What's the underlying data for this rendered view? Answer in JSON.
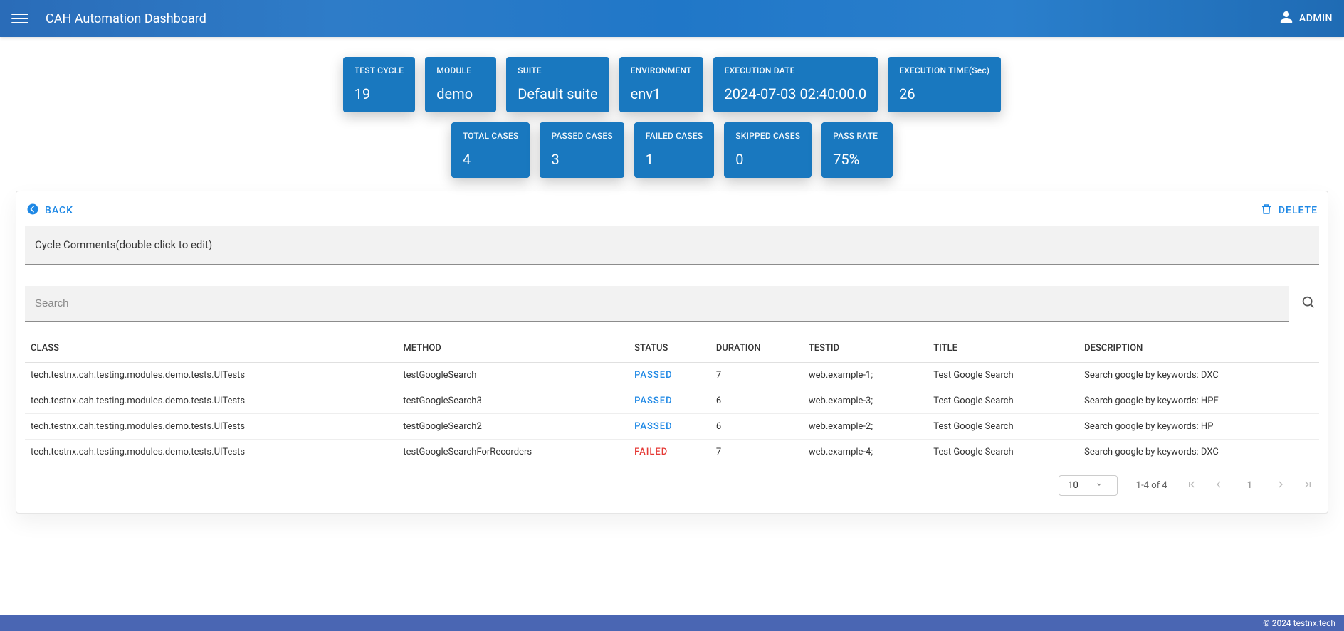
{
  "header": {
    "title": "CAH Automation Dashboard",
    "user": "ADMIN"
  },
  "summary": {
    "row1": [
      {
        "label": "TEST CYCLE",
        "value": "19"
      },
      {
        "label": "MODULE",
        "value": "demo"
      },
      {
        "label": "SUITE",
        "value": "Default suite"
      },
      {
        "label": "ENVIRONMENT",
        "value": "env1"
      },
      {
        "label": "EXECUTION DATE",
        "value": "2024-07-03 02:40:00.0"
      },
      {
        "label": "EXECUTION TIME(Sec)",
        "value": "26"
      }
    ],
    "row2": [
      {
        "label": "TOTAL CASES",
        "value": "4"
      },
      {
        "label": "PASSED CASES",
        "value": "3"
      },
      {
        "label": "FAILED CASES",
        "value": "1"
      },
      {
        "label": "SKIPPED CASES",
        "value": "0"
      },
      {
        "label": "PASS RATE",
        "value": "75%"
      }
    ]
  },
  "panel": {
    "back_label": "BACK",
    "delete_label": "DELETE",
    "comments_text": "Cycle Comments(double click to edit)",
    "search_placeholder": "Search"
  },
  "table": {
    "columns": [
      "CLASS",
      "METHOD",
      "STATUS",
      "DURATION",
      "TESTID",
      "TITLE",
      "DESCRIPTION"
    ],
    "rows": [
      {
        "class": "tech.testnx.cah.testing.modules.demo.tests.UITests",
        "method": "testGoogleSearch",
        "status": "PASSED",
        "duration": "7",
        "testid": "web.example-1;",
        "title": "Test Google Search",
        "description": "Search google by keywords: DXC"
      },
      {
        "class": "tech.testnx.cah.testing.modules.demo.tests.UITests",
        "method": "testGoogleSearch3",
        "status": "PASSED",
        "duration": "6",
        "testid": "web.example-3;",
        "title": "Test Google Search",
        "description": "Search google by keywords: HPE"
      },
      {
        "class": "tech.testnx.cah.testing.modules.demo.tests.UITests",
        "method": "testGoogleSearch2",
        "status": "PASSED",
        "duration": "6",
        "testid": "web.example-2;",
        "title": "Test Google Search",
        "description": "Search google by keywords: HP"
      },
      {
        "class": "tech.testnx.cah.testing.modules.demo.tests.UITests",
        "method": "testGoogleSearchForRecorders",
        "status": "FAILED",
        "duration": "7",
        "testid": "web.example-4;",
        "title": "Test Google Search",
        "description": "Search google by keywords: DXC"
      }
    ]
  },
  "paginator": {
    "page_size": "10",
    "range": "1-4 of 4",
    "current": "1"
  },
  "footer": "© 2024 testnx.tech"
}
